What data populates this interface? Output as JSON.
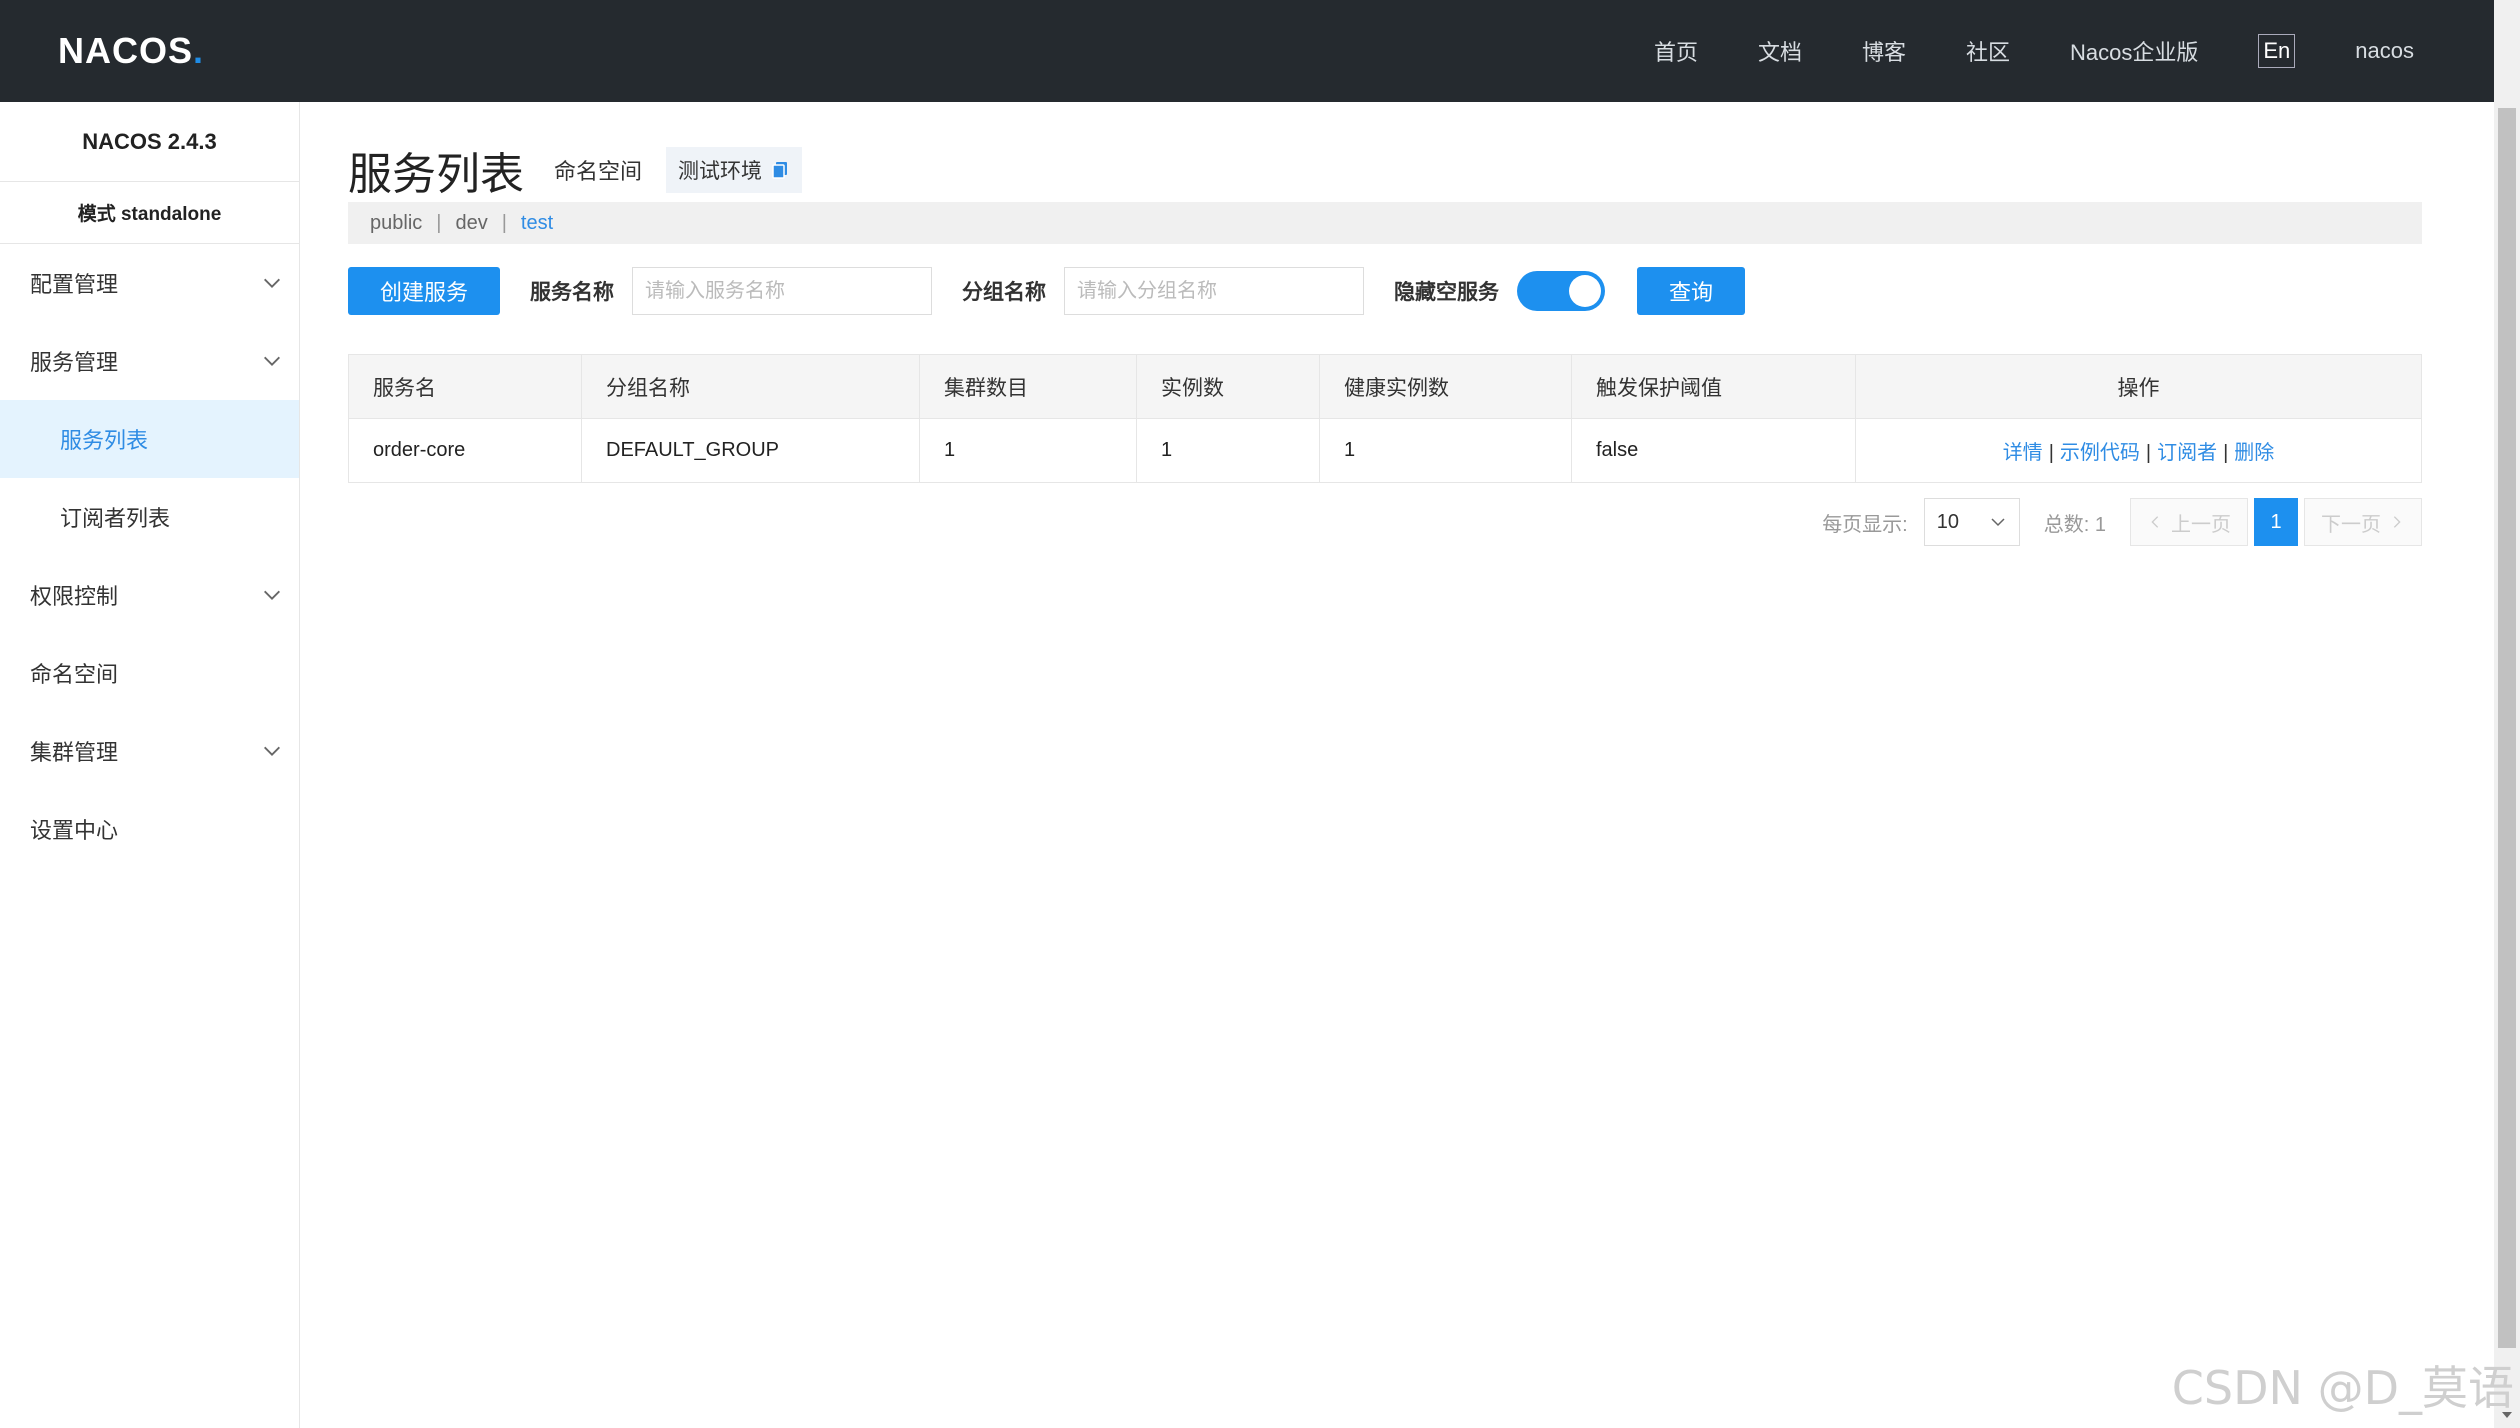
{
  "topbar": {
    "logo": "NACOS",
    "logo_dot": ".",
    "nav": [
      "首页",
      "文档",
      "博客",
      "社区",
      "Nacos企业版"
    ],
    "lang": "En",
    "user": "nacos"
  },
  "sidebar": {
    "version": "NACOS 2.4.3",
    "mode": "模式 standalone",
    "items": [
      {
        "label": "配置管理",
        "icon": "chevron-down-icon"
      },
      {
        "label": "服务管理",
        "icon": "chevron-down-icon"
      },
      {
        "label": "服务列表"
      },
      {
        "label": "订阅者列表"
      },
      {
        "label": "权限控制",
        "icon": "chevron-down-icon"
      },
      {
        "label": "命名空间"
      },
      {
        "label": "集群管理",
        "icon": "chevron-down-icon"
      },
      {
        "label": "设置中心"
      }
    ]
  },
  "main": {
    "title": "服务列表",
    "ns_label": "命名空间",
    "ns_current": "测试环境",
    "namespaces": [
      "public",
      "dev",
      "test"
    ],
    "namespace_separator": "|",
    "active_namespace": "test"
  },
  "filters": {
    "create_button": "创建服务",
    "service_name_label": "服务名称",
    "service_name_placeholder": "请输入服务名称",
    "group_name_label": "分组名称",
    "group_name_placeholder": "请输入分组名称",
    "hide_empty_label": "隐藏空服务",
    "hide_empty_on": true,
    "query_button": "查询"
  },
  "table": {
    "headers": [
      "服务名",
      "分组名称",
      "集群数目",
      "实例数",
      "健康实例数",
      "触发保护阈值",
      "操作"
    ],
    "rows": [
      {
        "service": "order-core",
        "group": "DEFAULT_GROUP",
        "clusters": "1",
        "instances": "1",
        "healthy": "1",
        "threshold": "false"
      }
    ],
    "ops": [
      "详情",
      "示例代码",
      "订阅者",
      "删除"
    ],
    "op_separator": "|"
  },
  "pagination": {
    "page_size_label": "每页显示:",
    "page_size": "10",
    "total_label": "总数: 1",
    "prev": "上一页",
    "current": "1",
    "next": "下一页"
  },
  "watermark": "CSDN @D_莫语",
  "colors": {
    "accent": "#1d90ef",
    "topbar": "#252a2f",
    "link": "#2f8ce4",
    "active_bg": "#e4f3fe"
  }
}
